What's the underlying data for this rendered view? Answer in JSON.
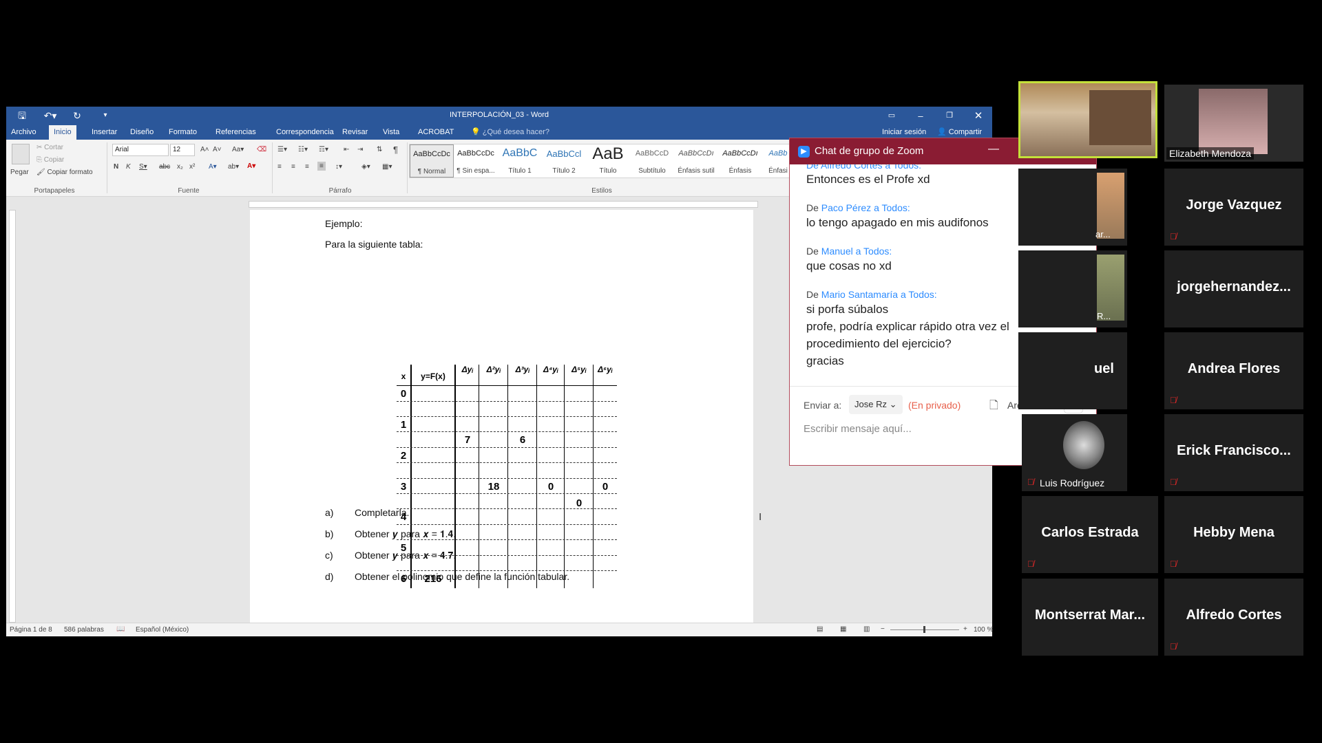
{
  "word": {
    "title": "INTERPOLACIÓN_03 - Word",
    "tabs": [
      "Archivo",
      "Inicio",
      "Insertar",
      "Diseño",
      "Formato",
      "Referencias",
      "Correspondencia",
      "Revisar",
      "Vista",
      "ACROBAT"
    ],
    "tell_me": "¿Qué desea hacer?",
    "signin": "Iniciar sesión",
    "share": "Compartir",
    "clipboard": {
      "paste": "Pegar",
      "cut": "Cortar",
      "copy": "Copiar",
      "format_painter": "Copiar formato",
      "label": "Portapapeles"
    },
    "font": {
      "name": "Arial",
      "size": "12",
      "label": "Fuente"
    },
    "paragraph_label": "Párrafo",
    "styles_label": "Estilos",
    "styles": [
      {
        "preview": "AaBbCcDc",
        "name": "¶ Normal"
      },
      {
        "preview": "AaBbCcDc",
        "name": "¶ Sin espa..."
      },
      {
        "preview": "AaBbC",
        "name": "Título 1"
      },
      {
        "preview": "AaBbCcl",
        "name": "Título 2"
      },
      {
        "preview": "AaB",
        "name": "Título"
      },
      {
        "preview": "AaBbCcD",
        "name": "Subtítulo"
      },
      {
        "preview": "AaBbCcDı",
        "name": "Énfasis sutil"
      },
      {
        "preview": "AaBbCcDı",
        "name": "Énfasis"
      },
      {
        "preview": "AaBb",
        "name": "Énfasi"
      }
    ],
    "doc": {
      "ejemplo": "Ejemplo:",
      "intro": "Para la siguiente tabla:",
      "table": {
        "headers": [
          "x",
          "y=F(x)",
          "Δyᵢ",
          "Δ²yᵢ",
          "Δ³yᵢ",
          "Δ⁴yᵢ",
          "Δ⁵yᵢ",
          "Δ⁶yᵢ"
        ],
        "x_values": [
          "0",
          "1",
          "2",
          "3",
          "4",
          "5",
          "6"
        ],
        "entries": {
          "d1": "7",
          "d3": "6",
          "d2": "18",
          "d4": "0",
          "d6": "0",
          "d5": "0",
          "y6": "216"
        }
      },
      "items": [
        {
          "letter": "a)",
          "text": "Completarla."
        },
        {
          "letter": "b)",
          "text": "Obtener 𝒚 para 𝒙 = 𝟏.𝟒."
        },
        {
          "letter": "c)",
          "text": "Obtener 𝒚 para 𝒙 = 𝟒.𝟕."
        },
        {
          "letter": "d)",
          "text": "Obtener el polinomio que define la función tabular."
        }
      ]
    },
    "status": {
      "page": "Página 1 de 8",
      "words": "586 palabras",
      "lang": "Español (México)",
      "zoom": "100 %"
    }
  },
  "chat": {
    "title": "Chat de grupo de Zoom",
    "partial_top": "De Alfredo Cortes a Todos:",
    "messages": [
      {
        "from": "",
        "text": "Entonces es el Profe xd"
      },
      {
        "from": "Paco Pérez",
        "to": "Todos",
        "text": "lo tengo apagado en mis audifonos"
      },
      {
        "from": "Manuel",
        "to": "Todos",
        "text": "que cosas no xd"
      },
      {
        "from": "Mario Santamaría",
        "to": "Todos",
        "text": "si porfa súbalos"
      },
      {
        "from": "",
        "text": "profe, podría explicar rápido otra vez el"
      },
      {
        "from": "",
        "text": "procedimiento del ejercicio?"
      },
      {
        "from": "",
        "text": "gracias"
      }
    ],
    "de": "De",
    "a": "a",
    "send_to_label": "Enviar a:",
    "recipient": "Jose Rz",
    "private": "(En privado)",
    "file": "Archivo",
    "more": "···",
    "placeholder": "Escribir mensaje aquí..."
  },
  "participants": [
    {
      "name": "",
      "video": true
    },
    {
      "name": "Elizabeth Mendoza",
      "video": true
    },
    {
      "name": "ar...",
      "video": true,
      "partial": true
    },
    {
      "name": "Jorge Vazquez"
    },
    {
      "name": "R...",
      "video": true,
      "partial": true
    },
    {
      "name": "jorgehernandez..."
    },
    {
      "name": "uel",
      "partial": true
    },
    {
      "name": "Andrea Flores"
    },
    {
      "name": "Luis Rodríguez",
      "video": true
    },
    {
      "name": "Erick  Francisco..."
    },
    {
      "name": "Carlos Estrada"
    },
    {
      "name": "Hebby Mena"
    },
    {
      "name": "Montserrat  Mar..."
    },
    {
      "name": "Alfredo Cortes"
    }
  ],
  "colors": {
    "word_blue": "#2b579a",
    "zoom_header": "#8a1c33",
    "zoom_link": "#2d8cff",
    "active_speaker": "#c4e13a"
  }
}
